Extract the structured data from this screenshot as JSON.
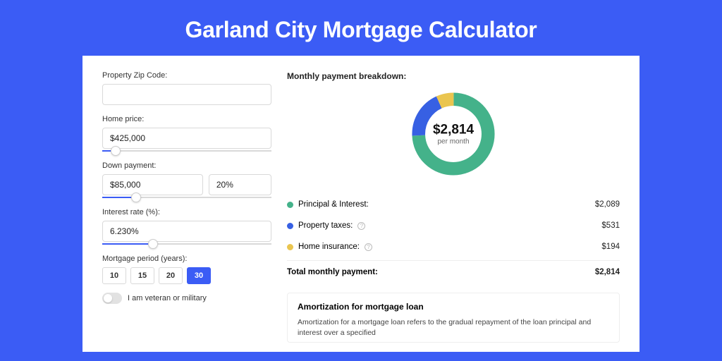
{
  "title": "Garland City Mortgage Calculator",
  "form": {
    "zip_label": "Property Zip Code:",
    "zip_value": "",
    "home_price_label": "Home price:",
    "home_price_value": "$425,000",
    "home_price_slider_pct": 8,
    "down_payment_label": "Down payment:",
    "down_payment_value": "$85,000",
    "down_payment_pct_value": "20%",
    "down_payment_slider_pct": 20,
    "interest_label": "Interest rate (%):",
    "interest_value": "6.230%",
    "interest_slider_pct": 30,
    "period_label": "Mortgage period (years):",
    "period_options": [
      "10",
      "15",
      "20",
      "30"
    ],
    "period_selected": "30",
    "veteran_label": "I am veteran or military"
  },
  "breakdown": {
    "title": "Monthly payment breakdown:",
    "center_value": "$2,814",
    "center_label": "per month",
    "items": [
      {
        "label": "Principal & Interest:",
        "value": "$2,089",
        "color": "green",
        "info": false
      },
      {
        "label": "Property taxes:",
        "value": "$531",
        "color": "blue",
        "info": true
      },
      {
        "label": "Home insurance:",
        "value": "$194",
        "color": "yellow",
        "info": true
      }
    ],
    "total_label": "Total monthly payment:",
    "total_value": "$2,814"
  },
  "amortization": {
    "title": "Amortization for mortgage loan",
    "text": "Amortization for a mortgage loan refers to the gradual repayment of the loan principal and interest over a specified"
  },
  "chart_data": {
    "type": "pie",
    "title": "Monthly payment breakdown",
    "series": [
      {
        "name": "Principal & Interest",
        "value": 2089,
        "color": "#44b28a"
      },
      {
        "name": "Property taxes",
        "value": 531,
        "color": "#3760e3"
      },
      {
        "name": "Home insurance",
        "value": 194,
        "color": "#eac54f"
      }
    ],
    "total": 2814,
    "donut": true,
    "center_label": "$2,814 per month"
  }
}
